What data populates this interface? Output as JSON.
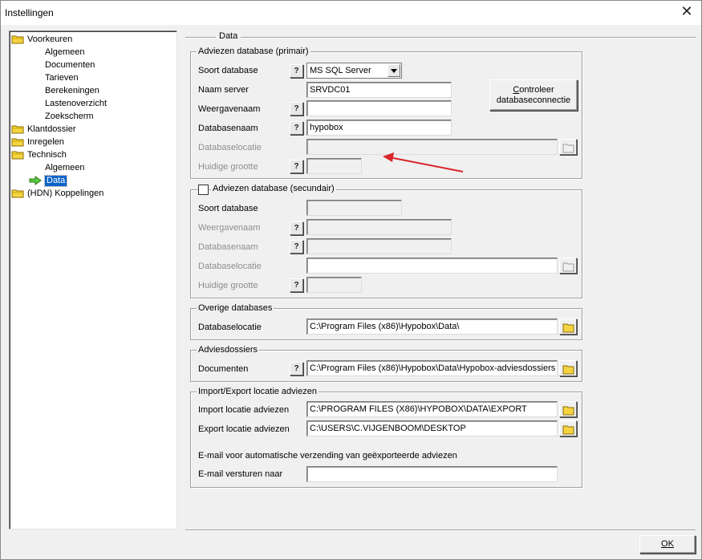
{
  "window": {
    "title": "Instellingen"
  },
  "tree": {
    "items": [
      {
        "label": "Voorkeuren",
        "type": "folder"
      },
      {
        "label": "Algemeen",
        "type": "leaf"
      },
      {
        "label": "Documenten",
        "type": "leaf"
      },
      {
        "label": "Tarieven",
        "type": "leaf"
      },
      {
        "label": "Berekeningen",
        "type": "leaf"
      },
      {
        "label": "Lastenoverzicht",
        "type": "leaf"
      },
      {
        "label": "Zoekscherm",
        "type": "leaf"
      },
      {
        "label": "Klantdossier",
        "type": "folder"
      },
      {
        "label": "Inregelen",
        "type": "folder"
      },
      {
        "label": "Technisch",
        "type": "folder"
      },
      {
        "label": "Algemeen",
        "type": "leaf"
      },
      {
        "label": "Data",
        "type": "leaf",
        "selected": true
      },
      {
        "label": "(HDN) Koppelingen",
        "type": "folder"
      }
    ]
  },
  "section": {
    "title": "Data"
  },
  "primary": {
    "title": "Adviezen database (primair)",
    "soort_label": "Soort database",
    "soort_value": "MS SQL Server",
    "server_label": "Naam server",
    "server_value": "SRVDC01",
    "weergave_label": "Weergavenaam",
    "weergave_value": "",
    "dbnaam_label": "Databasenaam",
    "dbnaam_value": "hypobox",
    "locatie_label": "Databaselocatie",
    "locatie_value": "",
    "grootte_label": "Huidige grootte",
    "grootte_value": "",
    "check_button_line1": "Controleer",
    "check_button_line2": "databaseconnectie",
    "check_button_mnemonic": "C"
  },
  "secondary": {
    "title": "Adviezen database (secundair)",
    "checked": false,
    "soort_label": "Soort database",
    "weergave_label": "Weergavenaam",
    "dbnaam_label": "Databasenaam",
    "locatie_label": "Databaselocatie",
    "grootte_label": "Huidige grootte"
  },
  "overige": {
    "title": "Overige databases",
    "locatie_label": "Databaselocatie",
    "locatie_value": "C:\\Program Files (x86)\\Hypobox\\Data\\"
  },
  "adviesdossiers": {
    "title": "Adviesdossiers",
    "documenten_label": "Documenten",
    "documenten_value": "C:\\Program Files (x86)\\Hypobox\\Data\\Hypobox-adviesdossiers"
  },
  "importexport": {
    "title": "Import/Export locatie adviezen",
    "import_label": "Import locatie adviezen",
    "import_value": "C:\\PROGRAM FILES (X86)\\HYPOBOX\\DATA\\EXPORT",
    "export_label": "Export locatie adviezen",
    "export_value": "C:\\USERS\\C.VIJGENBOOM\\DESKTOP",
    "email_note": "E-mail voor automatische verzending van geëxporteerde adviezen",
    "email_label": "E-mail versturen naar",
    "email_value": ""
  },
  "buttons": {
    "ok": "OK",
    "help": "?"
  },
  "colors": {
    "selection": "#0a64c8",
    "annotation_arrow": "#d9262a",
    "folder": "#f5d442"
  }
}
